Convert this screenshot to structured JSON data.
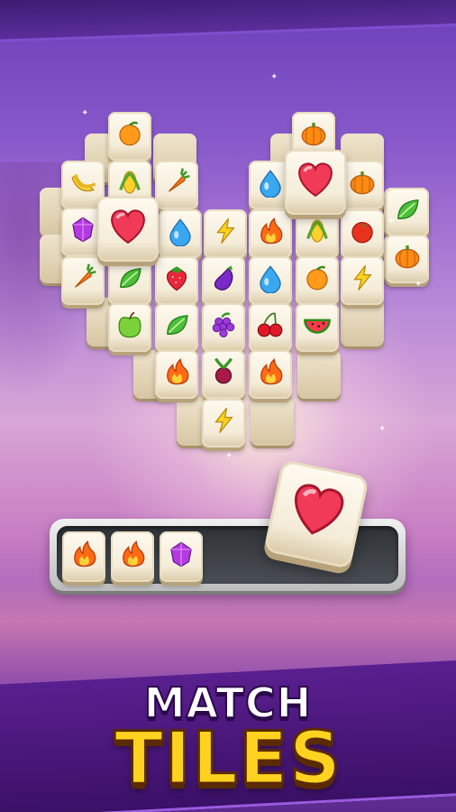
{
  "title": {
    "line1": "MATCH",
    "line2": "TILES"
  },
  "colors": {
    "accent_yellow": "#ffd21f",
    "band_purple": "#4a1878"
  },
  "board": {
    "tiles_icons": [
      "orange-icon",
      "tomato-icon",
      "pumpkin-icon",
      "banana-icon",
      "corn-icon",
      "carrot-icon",
      "water-drop-icon",
      "heart-icon",
      "gem-icon",
      "lightning-icon",
      "fire-icon",
      "strawberry-icon",
      "eggplant-icon",
      "apple-icon",
      "leaf-icon",
      "grapes-icon",
      "cherries-icon",
      "watermelon-icon",
      "beet-icon"
    ]
  },
  "tray": {
    "slots": [
      "fire-icon",
      "fire-icon",
      "gem-icon"
    ]
  },
  "moving_tile": "heart-icon"
}
